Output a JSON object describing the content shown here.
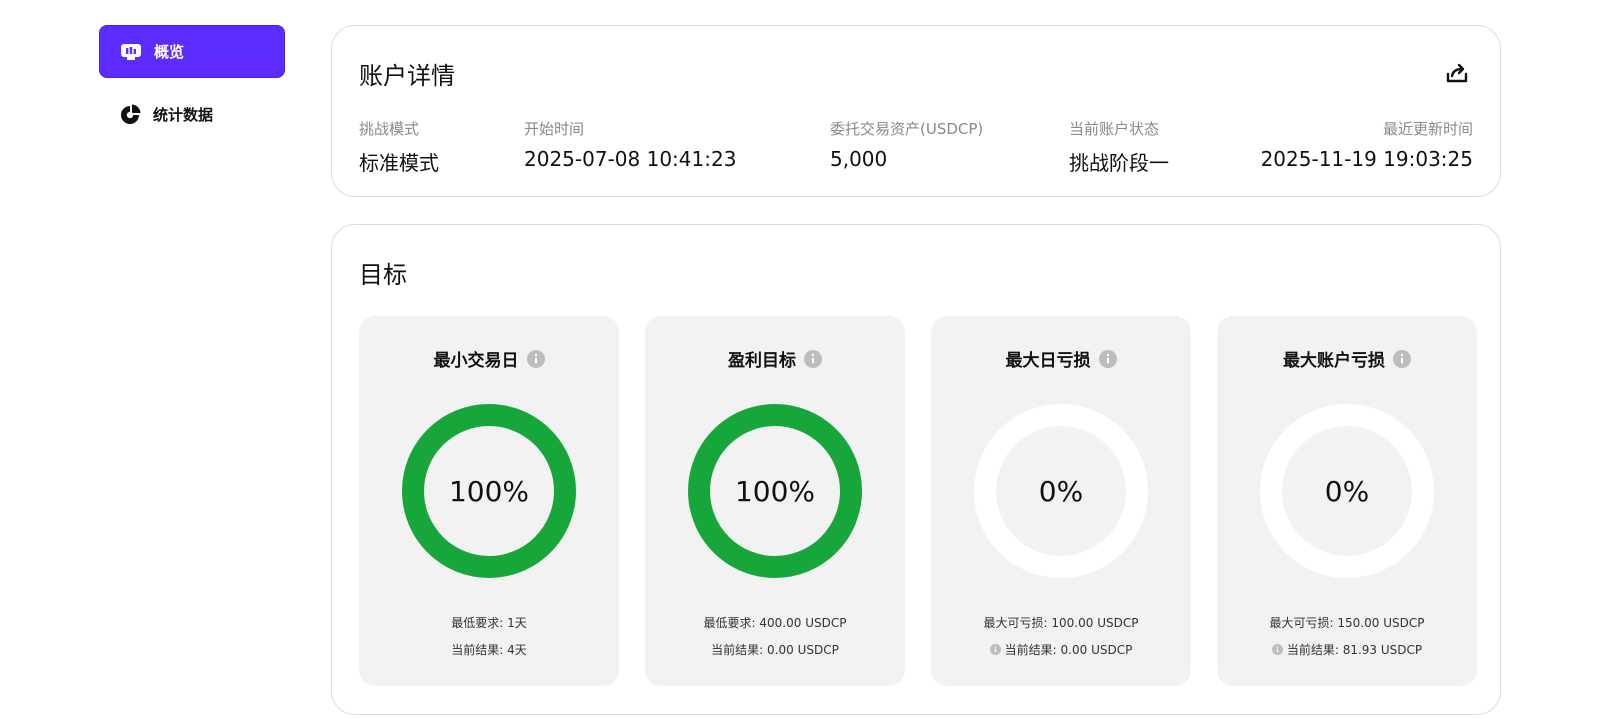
{
  "sidebar": {
    "items": [
      {
        "label": "概览",
        "icon": "bar-chart-icon",
        "active": true
      },
      {
        "label": "统计数据",
        "icon": "pie-chart-icon",
        "active": false
      }
    ],
    "accent_color": "#5b2bff"
  },
  "account": {
    "title": "账户详情",
    "fields": [
      {
        "label": "挑战模式",
        "value": "标准模式"
      },
      {
        "label": "开始时间",
        "value": "2025-07-08 10:41:23"
      },
      {
        "label": "委托交易资产(USDCP)",
        "value": "5,000"
      },
      {
        "label": "当前账户状态",
        "value": "挑战阶段一"
      },
      {
        "label": "最近更新时间",
        "value": "2025-11-19 19:03:25"
      }
    ]
  },
  "goals": {
    "title": "目标",
    "success_color": "#16a63a",
    "tiles": [
      {
        "title": "最小交易日",
        "percent_text": "100%",
        "progress": 1.0,
        "line1": "最低要求: 1天",
        "line2": "当前结果: 4天",
        "line1_info": false,
        "line2_info": false
      },
      {
        "title": "盈利目标",
        "percent_text": "100%",
        "progress": 1.0,
        "line1": "最低要求: 400.00 USDCP",
        "line2": "当前结果: 0.00 USDCP",
        "line1_info": false,
        "line2_info": false
      },
      {
        "title": "最大日亏损",
        "percent_text": "0%",
        "progress": 0.0,
        "line1": "最大可亏损: 100.00 USDCP",
        "line2": "当前结果: 0.00 USDCP",
        "line1_info": false,
        "line2_info": true
      },
      {
        "title": "最大账户亏损",
        "percent_text": "0%",
        "progress": 0.0,
        "line1": "最大可亏损: 150.00 USDCP",
        "line2": "当前结果: 81.93 USDCP",
        "line1_info": false,
        "line2_info": true
      }
    ]
  }
}
